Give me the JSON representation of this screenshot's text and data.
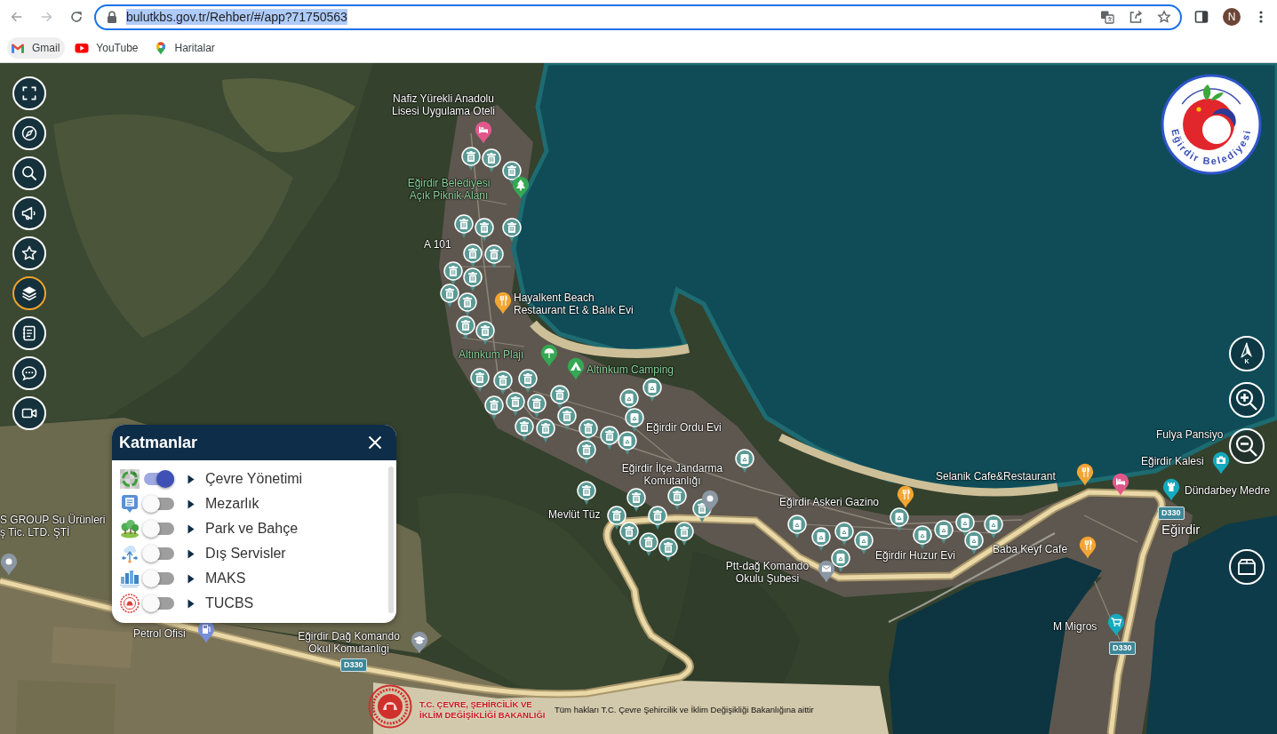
{
  "browser": {
    "url": "bulutkbs.gov.tr/Rehber/#/app?71750563",
    "url_selected": true,
    "profile_initial": "N",
    "bookmarks": [
      {
        "label": "Gmail",
        "highlighted": true
      },
      {
        "label": "YouTube",
        "highlighted": false
      },
      {
        "label": "Haritalar",
        "highlighted": false
      }
    ]
  },
  "toolbar": [
    {
      "selected": false
    },
    {
      "selected": false
    },
    {
      "selected": false
    },
    {
      "selected": false
    },
    {
      "selected": false
    },
    {
      "selected": true
    },
    {
      "selected": false
    },
    {
      "selected": false
    },
    {
      "selected": false
    }
  ],
  "logo": {
    "text": "Eğirdir Belediyesi"
  },
  "map_controls": {
    "north_label": "K"
  },
  "layers_panel": {
    "title": "Katmanlar",
    "layers": [
      {
        "label": "Çevre Yönetimi",
        "on": true,
        "expanded": false
      },
      {
        "label": "Mezarlık",
        "on": false,
        "expanded": false
      },
      {
        "label": "Park ve Bahçe",
        "on": false,
        "expanded": false
      },
      {
        "label": "Dış Servisler",
        "on": false,
        "expanded": false
      },
      {
        "label": "MAKS",
        "on": false,
        "expanded": false
      },
      {
        "label": "TUCBS",
        "on": false,
        "expanded": false
      }
    ]
  },
  "map": {
    "labels": [
      {
        "text": "Nafiz Yürekli Anadolu Lisesi Uygulama Oteli",
        "kind": "place"
      },
      {
        "text": "Eğirdir Belediyesi Açık Piknik Alanı",
        "kind": "park"
      },
      {
        "text": "A 101",
        "kind": "place"
      },
      {
        "text": "Hayalkent Beach Restaurant Et & Balık Evi",
        "kind": "place"
      },
      {
        "text": "Altınkum Plajı",
        "kind": "park"
      },
      {
        "text": "Altınkum Camping",
        "kind": "park"
      },
      {
        "text": "Eğirdir Ordu Evi",
        "kind": "place"
      },
      {
        "text": "Eğirdir İlçe Jandarma Komutanlığı",
        "kind": "place"
      },
      {
        "text": "Mevlüt Tüz",
        "kind": "place"
      },
      {
        "text": "Eğirdir Askeri Gazino",
        "kind": "place"
      },
      {
        "text": "Eğirdir Huzur Evi",
        "kind": "place"
      },
      {
        "text": "Ptt-dağ Komando Okulu Şubesi",
        "kind": "place"
      },
      {
        "text": "Selanik Cafe&Restaurant",
        "kind": "place"
      },
      {
        "text": "Fulya Pansiyo",
        "kind": "place"
      },
      {
        "text": "Eğirdir Kalesi",
        "kind": "place"
      },
      {
        "text": "Dündarbey Medre",
        "kind": "place"
      },
      {
        "text": "Eğirdir",
        "kind": "town"
      },
      {
        "text": "Baba Keyf Cafe",
        "kind": "place"
      },
      {
        "text": "M Migros",
        "kind": "place"
      },
      {
        "text": "S GROUP Su Ürünleri ş Tic. LTD. ŞTİ",
        "kind": "place"
      },
      {
        "text": "Petrol Ofisi",
        "kind": "place"
      },
      {
        "text": "Eğirdir Dağ Komando Okul Komutanligi",
        "kind": "place"
      }
    ],
    "route_shields": [
      "D330",
      "D330",
      "D330"
    ]
  },
  "footer": {
    "ministry": "T.C. ÇEVRE, ŞEHİRCİLİK VE İKLİM DEĞİŞİKLİĞİ BAKANLIĞI",
    "copyright": "Tüm hakları T.C. Çevre Şehircilik ve İklim Değişikliği Bakanlığına aittir"
  }
}
